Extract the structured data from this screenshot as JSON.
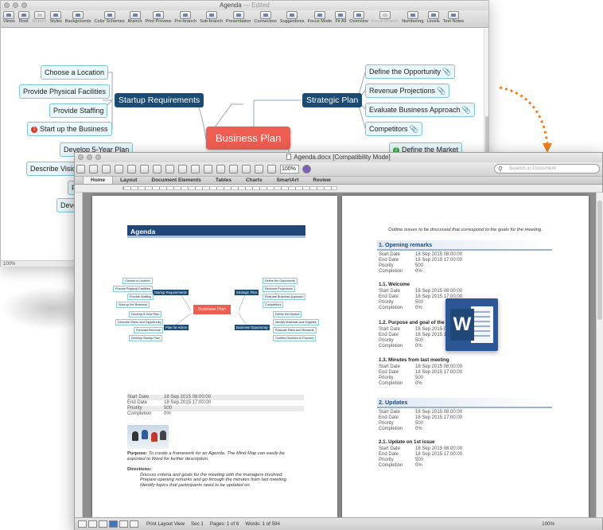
{
  "mindmap_window": {
    "title": "Agenda",
    "status": "— Edited",
    "zoom": "100%",
    "toolbar": [
      "Views",
      "Root",
      "Branch",
      "Styles",
      "Backgrounds",
      "Color Schemes",
      "Branch",
      "Print Preview",
      "Pre-branch",
      "Sub-branch",
      "Presentation",
      "Connection",
      "Suggestions",
      "Focus Mode",
      "Fit All",
      "Overview",
      "Focus Branch",
      "Numbering",
      "Levels",
      "Text Notes"
    ],
    "toolbar_disabled": [
      "Branch",
      "Focus Branch"
    ],
    "central": "Business Plan",
    "left_main": "Startup Requirements",
    "right_main": "Strategic Plan",
    "left_items": [
      "Choose a Location",
      "Provide Physical Facilities",
      "Provide Staffing",
      "Start up the Business"
    ],
    "left_badge": "1",
    "right_items": [
      "Define the Opportunity",
      "Revenue Projections",
      "Evaluate Business Approach",
      "Competitors"
    ],
    "lower_left": [
      "Develop 5-Year  Plan",
      "Describe Vision",
      "Fo",
      "Deve"
    ],
    "lower_right": "Define the Market",
    "lower_right_badge": "2"
  },
  "word_window": {
    "title": "Agenda.docx [Compatibility Mode]",
    "zoom": "100%",
    "search_placeholder": "Search in Document",
    "tabs": [
      "Home",
      "Layout",
      "Document Elements",
      "Tables",
      "Charts",
      "SmartArt",
      "Review"
    ],
    "status": {
      "view": "Print Layout View",
      "sec": "Sec  1",
      "pages": "Pages:",
      "pages_val": "1 of 6",
      "words": "Words:",
      "words_val": "1 of 594",
      "zoom": "100%"
    }
  },
  "page1": {
    "heading": "Agenda",
    "mini": {
      "central": "Business Plan",
      "mains": [
        "Startup Requirements",
        "Strategic Plan",
        "Plan for Action",
        "Business Opportunity"
      ],
      "left": [
        "Choose a Location",
        "Provide Physical Facilities",
        "Provide Staffing",
        "Start up the Business",
        "Develop 5-Year  Plan",
        "Describe Vision and Opportunity",
        "Forecast Revenue",
        "Develop Startup Plan"
      ],
      "right": [
        "Define the Opportunity",
        "Revenue Projections",
        "Evaluate Business Approach",
        "Competitors",
        "Define the Market",
        "Identify Materials and Supplies",
        "Evaluate Risks and Rewards",
        "Confirm Decision to Proceed"
      ]
    },
    "props": [
      [
        "Start Date",
        "18 Sep 2015 08:00:00"
      ],
      [
        "End Date",
        "18 Sep 2015 17:00:00"
      ],
      [
        "Priority",
        "500"
      ],
      [
        "Completion",
        "0%"
      ]
    ],
    "purpose_label": "Purpose:",
    "purpose_text": "To create a framework for an Agenda. The Mind Map can easily be exported to Word for further description.",
    "directions_label": "Directions:",
    "directions": [
      "Discuss criteria and goals for the meeting with the managers involved.",
      "Prepare opening remarks and go through the minutes from last meeting.",
      "Identify topics that participants need to be updated on."
    ]
  },
  "page2": {
    "intro": "Outline issues to be discussed that correspond to the goals for the meeting.",
    "s1": "1. Opening remarks",
    "s11": "1.1. Welcome",
    "s12": "1.2. Purpose and goal of the meeting",
    "s13": "1.3. Minutes from last meeting",
    "s2": "2. Updates",
    "s21": "2.1. Update on 1st issue",
    "props": [
      [
        "Start Date",
        "18 Sep 2015 08:00:00"
      ],
      [
        "End Date",
        "18 Sep 2015 17:00:00"
      ],
      [
        "Priority",
        "500"
      ],
      [
        "Completion",
        "0%"
      ]
    ]
  },
  "colors": {
    "central": "#ee5e52",
    "main": "#1b4a72",
    "accent_orange": "#f07f1e",
    "word_blue": "#2b5797"
  }
}
